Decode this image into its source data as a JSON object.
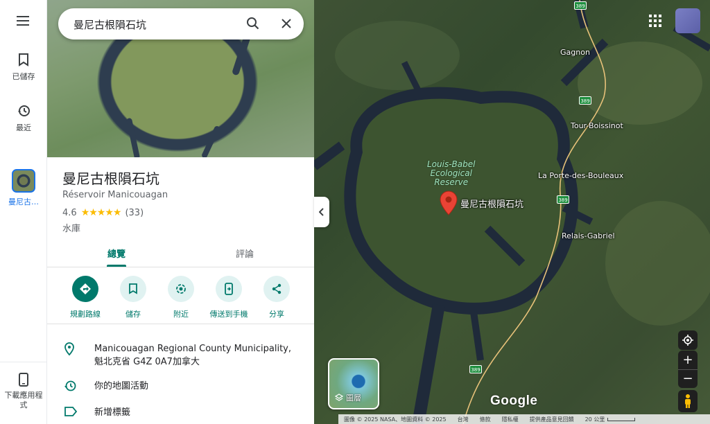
{
  "rail": {
    "saved_label": "已儲存",
    "recent_label": "最近",
    "place_label": "曼尼古…",
    "download_label": "下載應用程式"
  },
  "search": {
    "query": "曼尼古根隕石坑"
  },
  "place": {
    "title": "曼尼古根隕石坑",
    "subtitle": "Réservoir Manicouagan",
    "rating": "4.6",
    "stars": "★★★★★",
    "review_count": "(33)",
    "category": "水庫"
  },
  "tabs": {
    "overview": "總覽",
    "reviews": "評論"
  },
  "actions": {
    "directions": "規劃路線",
    "save": "儲存",
    "nearby": "附近",
    "send_to_phone": "傳送到手機",
    "share": "分享"
  },
  "info": {
    "address": "Manicouagan Regional County Municipality, 魁北克省 G4Z 0A7加拿大",
    "activity": "你的地圖活動",
    "add_label": "新增標籤"
  },
  "map": {
    "reserve_label_1": "Louis-Babel",
    "reserve_label_2": "Ecological",
    "reserve_label_3": "Reserve",
    "pin_label": "曼尼古根隕石坑",
    "gagnon": "Gagnon",
    "tour_boissinot": "Tour-Boissinot",
    "la_porte": "La Porte-des-Bouleaux",
    "relais_gabriel": "Relais-Gabriel",
    "route_number": "389",
    "layers_label": "圖層",
    "google_logo": "Google",
    "colors": {
      "accent": "#00796b",
      "pin": "#ea4335"
    }
  },
  "footer": {
    "imagery": "圖像 © 2025 NASA、地圖資料 © 2025",
    "taiwan": "台灣",
    "terms": "條款",
    "privacy": "隱私權",
    "feedback": "提供產品意見回饋",
    "scale": "20 公里"
  }
}
